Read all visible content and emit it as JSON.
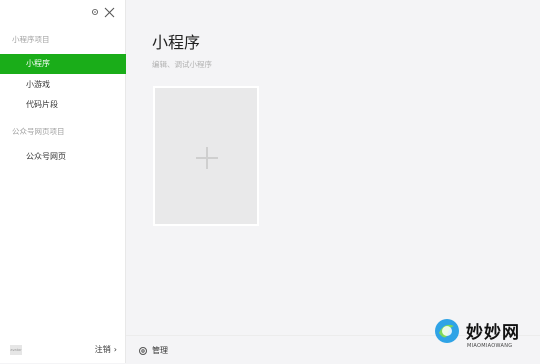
{
  "sidebar": {
    "controls": {
      "settings": "gear-icon",
      "close": "close-icon"
    },
    "groups": [
      {
        "title": "小程序项目",
        "items": [
          "小程序",
          "小游戏",
          "代码片段"
        ]
      },
      {
        "title": "公众号网页项目",
        "items": [
          "公众号网页"
        ]
      }
    ],
    "active_item": "小程序",
    "footer": {
      "avatar_text": "avatar",
      "logout_label": "注销"
    }
  },
  "main": {
    "title": "小程序",
    "subtitle": "编辑、调试小程序",
    "add_card_icon": "plus-icon",
    "bottom_bar": {
      "manage_label": "管理",
      "manage_icon": "gear-icon"
    }
  },
  "watermark": {
    "brand": "妙妙网",
    "sub": "MIAOMIAOWANG"
  },
  "colors": {
    "accent": "#1aad19",
    "background": "#f4f4f6",
    "sidebar": "#ffffff"
  }
}
